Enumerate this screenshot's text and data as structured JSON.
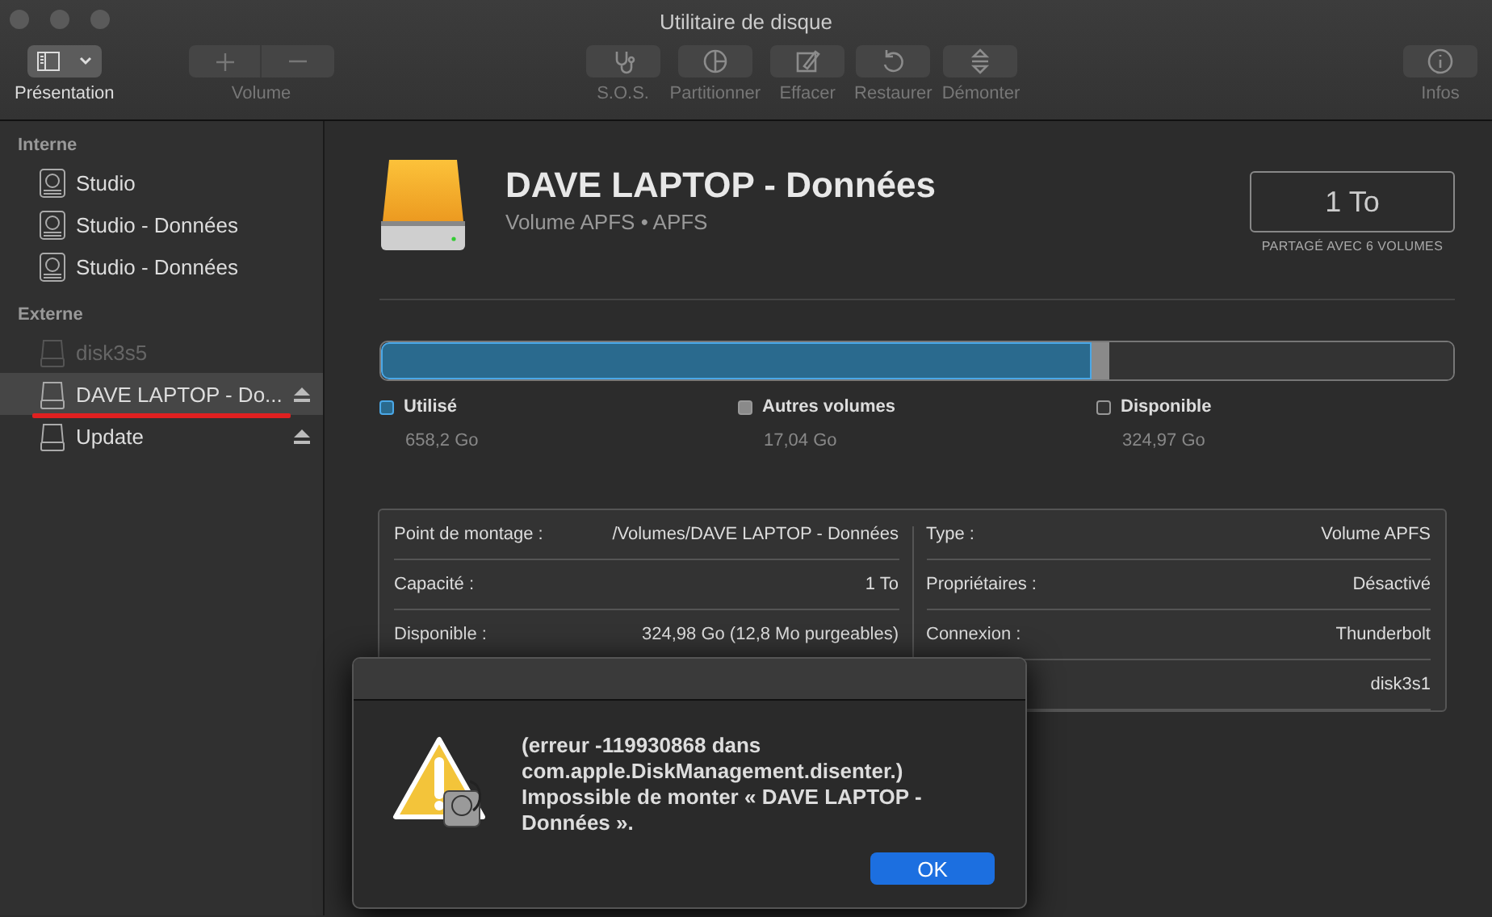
{
  "window": {
    "title": "Utilitaire de disque"
  },
  "toolbar": [
    {
      "kind": "view",
      "label": "Présentation",
      "disabled": false
    },
    {
      "kind": "volume",
      "label": "Volume",
      "disabled": true
    },
    {
      "kind": "sos",
      "label": "S.O.S.",
      "disabled": true
    },
    {
      "kind": "partition",
      "label": "Partitionner",
      "disabled": true
    },
    {
      "kind": "erase",
      "label": "Effacer",
      "disabled": true
    },
    {
      "kind": "restore",
      "label": "Restaurer",
      "disabled": true
    },
    {
      "kind": "unmount",
      "label": "Démonter",
      "disabled": true
    },
    {
      "kind": "info",
      "label": "Infos",
      "disabled": true
    }
  ],
  "sidebar": {
    "sections": [
      {
        "title": "Interne",
        "items": [
          {
            "label": "Studio",
            "kind": "internal",
            "disabled": false,
            "selected": false,
            "ejectable": false
          },
          {
            "label": "Studio - Données",
            "kind": "internal",
            "disabled": false,
            "selected": false,
            "ejectable": false
          },
          {
            "label": "Studio - Données",
            "kind": "internal",
            "disabled": false,
            "selected": false,
            "ejectable": false
          }
        ]
      },
      {
        "title": "Externe",
        "items": [
          {
            "label": "disk3s5",
            "kind": "external",
            "disabled": true,
            "selected": false,
            "ejectable": false
          },
          {
            "label": "DAVE LAPTOP - Do...",
            "kind": "external",
            "disabled": false,
            "selected": true,
            "ejectable": true
          },
          {
            "label": "Update",
            "kind": "external",
            "disabled": false,
            "selected": false,
            "ejectable": true
          }
        ]
      }
    ]
  },
  "volume": {
    "name": "DAVE LAPTOP - Données",
    "subtitle": "Volume APFS • APFS",
    "capacity": "1 To",
    "shared_note": "PARTAGÉ AVEC 6 VOLUMES"
  },
  "usage": [
    {
      "label": "Utilisé",
      "value": "658,2 Go",
      "level": 0.663,
      "color": "#2a6a8e"
    },
    {
      "label": "Autres volumes",
      "value": "17,04 Go",
      "level": 0.016,
      "color": "#8a8a8a"
    },
    {
      "label": "Disponible",
      "value": "324,97 Go",
      "level": 0.321,
      "color": "#333333"
    }
  ],
  "info": {
    "left": [
      {
        "label": "Point de montage :",
        "value": "/Volumes/DAVE LAPTOP - Données"
      },
      {
        "label": "Capacité :",
        "value": "1 To"
      },
      {
        "label": "Disponible :",
        "value": "324,98 Go (12,8 Mo purgeables)"
      }
    ],
    "right": [
      {
        "label": "Type :",
        "value": "Volume APFS"
      },
      {
        "label": "Propriétaires :",
        "value": "Désactivé"
      },
      {
        "label": "Connexion :",
        "value": "Thunderbolt"
      },
      {
        "value": "disk3s1"
      }
    ]
  },
  "dialog": {
    "message": "(erreur -119930868 dans com.apple.DiskManagement.disenter.) Impossible de monter « DAVE LAPTOP - Données ».",
    "buttons": [
      "OK"
    ]
  }
}
